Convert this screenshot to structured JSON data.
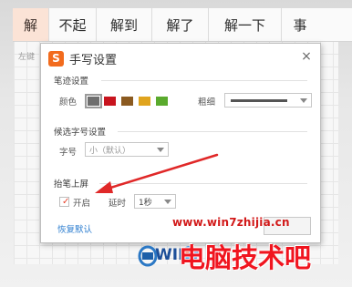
{
  "candidate_bar": {
    "items": [
      "解",
      "不起",
      "解到",
      "解了",
      "解一下",
      "事"
    ]
  },
  "dialog": {
    "title": "手写设置",
    "logo_letter": "S",
    "close_glyph": "×",
    "stroke_section": {
      "heading": "笔迹设置",
      "color_label": "颜色",
      "colors": [
        "#6e6e6e",
        "#c8141e",
        "#8b5a20",
        "#e0a41e",
        "#5aaa2d"
      ],
      "thickness_label": "粗细"
    },
    "candidate_section": {
      "heading": "候选字号设置",
      "size_label": "字号",
      "size_value": "小（默认）"
    },
    "lift_section": {
      "heading": "抬笔上屏",
      "enable_label": "开启",
      "enabled": true,
      "delay_label": "延时",
      "delay_value": "1秒"
    },
    "restore_default": "恢复默认"
  },
  "background": {
    "left_hint": "左键"
  },
  "watermark": {
    "url": "www.win7zhijia.cn",
    "logo_text": "WIN7",
    "brand_text": "电脑技术吧"
  },
  "colors": {
    "accent_orange": "#f26b1d",
    "annotation_red": "#e02828",
    "link_blue": "#2f7fd0"
  }
}
